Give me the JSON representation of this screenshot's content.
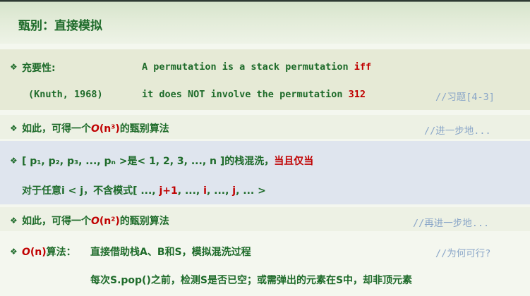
{
  "title": "甄别：直接模拟",
  "bullet": "❖",
  "section1": {
    "label": "充要性:",
    "line1_text": "A permutation is a stack permutation ",
    "line1_red": "iff",
    "citation": "(Knuth, 1968)",
    "line2_text": "it does NOT involve the permutation ",
    "line2_red": "312",
    "comment": "//习题[4-3]"
  },
  "section2": {
    "text_pre": "如此，可得一个",
    "big_o": "O",
    "complexity": "(n³)",
    "text_post": "的甄别算法",
    "comment": "//进一步地..."
  },
  "section3": {
    "line1_pre": "[ p₁, p₂, p₃, ..., pₙ >是< 1, 2, 3, ..., n ]的栈混洗，",
    "line1_red": "当且仅当",
    "line2_pre": "对于任意i < j，不含模式[ ..., ",
    "line2_r1": "j+1",
    "line2_mid1": ", ..., ",
    "line2_r2": "i",
    "line2_mid2": ", ..., ",
    "line2_r3": "j",
    "line2_end": ", ... >"
  },
  "section4": {
    "text_pre": "如此，可得一个",
    "big_o": "O",
    "complexity": "(n²)",
    "text_post": "的甄别算法",
    "comment": "//再进一步地..."
  },
  "section5": {
    "big_o": "O",
    "complexity": "(n)",
    "label": "算法：",
    "text": "直接借助栈A、B和S，模拟混洗过程",
    "comment": "//为何可行?",
    "line2": "每次S.pop()之前，检测S是否已空；或需弹出的元素在S中，却非顶元素"
  },
  "colors": {
    "accent_green": "#1e6b2a",
    "accent_red": "#c00000",
    "comment_blue": "#8aa6c8"
  }
}
